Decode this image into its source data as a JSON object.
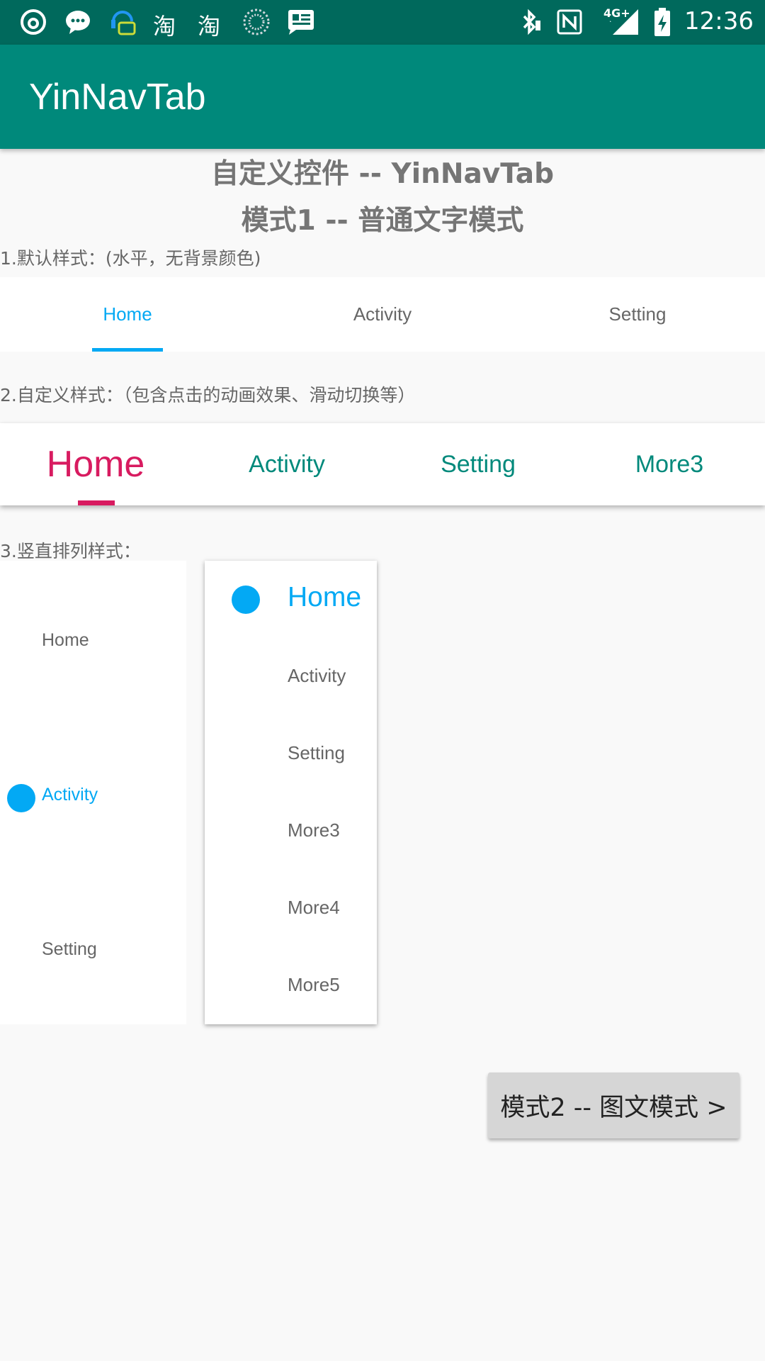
{
  "status_bar": {
    "time": "12:36",
    "network": "4G+",
    "left_icons": [
      "netease-music-icon",
      "message-icon",
      "support-chat-icon",
      "taobao-icon",
      "taobao-icon",
      "loading-icon",
      "news-icon"
    ],
    "right_icons": [
      "bluetooth-icon",
      "nfc-icon",
      "signal-icon",
      "battery-charging-icon"
    ]
  },
  "app_bar": {
    "title": "YinNavTab"
  },
  "header": {
    "title": "自定义控件 -- YinNavTab",
    "subtitle": "模式1 -- 普通文字模式"
  },
  "section1": {
    "label": "1.默认样式：(水平，无背景颜色)",
    "tabs": [
      "Home",
      "Activity",
      "Setting"
    ],
    "active_index": 0
  },
  "section2": {
    "label": "2.自定义样式：（包含点击的动画效果、滑动切换等）",
    "tabs": [
      "Home",
      "Activity",
      "Setting",
      "More3"
    ],
    "active_index": 0
  },
  "section3": {
    "label": "3.竖直排列样式：",
    "panel1": {
      "tabs": [
        "Home",
        "Activity",
        "Setting"
      ],
      "active_index": 1
    },
    "panel2": {
      "tabs": [
        "Home",
        "Activity",
        "Setting",
        "More3",
        "More4",
        "More5"
      ],
      "active_index": 0
    }
  },
  "mode2_button": {
    "label": "模式2 -- 图文模式 >"
  },
  "colors": {
    "status_bar": "#00695c",
    "app_bar": "#00897b",
    "accent_blue": "#03a9f4",
    "accent_pink": "#d81b60",
    "teal_text": "#00897b"
  }
}
